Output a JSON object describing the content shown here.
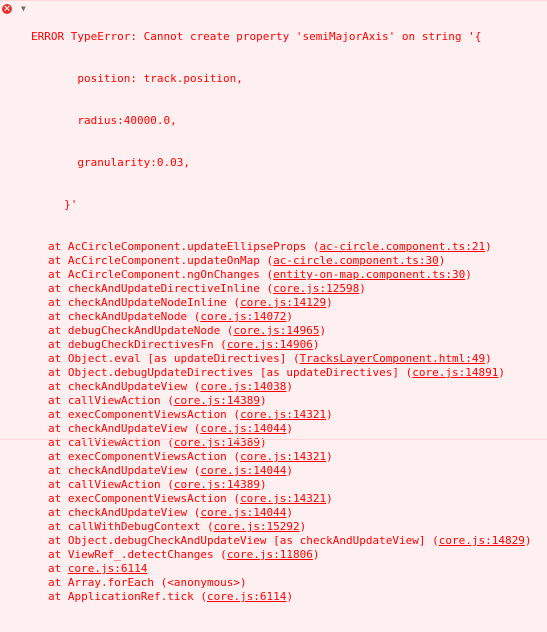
{
  "colors": {
    "background": "#fef0f0",
    "error_text": "#ff0000",
    "error_icon": "#e8312f",
    "toggle_icon": "#6b6b6b"
  },
  "icons": {
    "error": "error-icon",
    "toggle": "triangle-down-icon"
  },
  "console": {
    "header_lines": [
      "ERROR TypeError: Cannot create property 'semiMajorAxis' on string '{",
      "       position: track.position,",
      "       radius:40000.0,",
      "       granularity:0.03,",
      "     }'"
    ],
    "stack": [
      {
        "text": "at AcCircleComponent.updateEllipseProps (",
        "link": "ac-circle.component.ts:21",
        "suffix": ")"
      },
      {
        "text": "at AcCircleComponent.updateOnMap (",
        "link": "ac-circle.component.ts:30",
        "suffix": ")"
      },
      {
        "text": "at AcCircleComponent.ngOnChanges (",
        "link": "entity-on-map.component.ts:30",
        "suffix": ")"
      },
      {
        "text": "at checkAndUpdateDirectiveInline (",
        "link": "core.js:12598",
        "suffix": ")"
      },
      {
        "text": "at checkAndUpdateNodeInline (",
        "link": "core.js:14129",
        "suffix": ")"
      },
      {
        "text": "at checkAndUpdateNode (",
        "link": "core.js:14072",
        "suffix": ")"
      },
      {
        "text": "at debugCheckAndUpdateNode (",
        "link": "core.js:14965",
        "suffix": ")"
      },
      {
        "text": "at debugCheckDirectivesFn (",
        "link": "core.js:14906",
        "suffix": ")"
      },
      {
        "text": "at Object.eval [as updateDirectives] (",
        "link": "TracksLayerComponent.html:49",
        "suffix": ")"
      },
      {
        "text": "at Object.debugUpdateDirectives [as updateDirectives] (",
        "link": "core.js:14891",
        "suffix": ")"
      },
      {
        "text": "at checkAndUpdateView (",
        "link": "core.js:14038",
        "suffix": ")"
      },
      {
        "text": "at callViewAction (",
        "link": "core.js:14389",
        "suffix": ")"
      },
      {
        "text": "at execComponentViewsAction (",
        "link": "core.js:14321",
        "suffix": ")"
      },
      {
        "text": "at checkAndUpdateView (",
        "link": "core.js:14044",
        "suffix": ")"
      },
      {
        "text": "at callViewAction (",
        "link": "core.js:14389",
        "suffix": ")"
      },
      {
        "text": "at execComponentViewsAction (",
        "link": "core.js:14321",
        "suffix": ")"
      },
      {
        "text": "at checkAndUpdateView (",
        "link": "core.js:14044",
        "suffix": ")"
      },
      {
        "text": "at callViewAction (",
        "link": "core.js:14389",
        "suffix": ")"
      },
      {
        "text": "at execComponentViewsAction (",
        "link": "core.js:14321",
        "suffix": ")"
      },
      {
        "text": "at checkAndUpdateView (",
        "link": "core.js:14044",
        "suffix": ")"
      },
      {
        "text": "at callWithDebugContext (",
        "link": "core.js:15292",
        "suffix": ")"
      },
      {
        "text": "at Object.debugCheckAndUpdateView [as checkAndUpdateView] (",
        "link": "core.js:14829",
        "suffix": ")"
      },
      {
        "text": "at ViewRef_.detectChanges (",
        "link": "core.js:11806",
        "suffix": ")"
      },
      {
        "text": "at ",
        "link": "core.js:6114",
        "suffix": ""
      },
      {
        "text": "at Array.forEach (<anonymous>)",
        "link": "",
        "suffix": ""
      },
      {
        "text": "at ApplicationRef.tick (",
        "link": "core.js:6114",
        "suffix": ")"
      }
    ]
  }
}
